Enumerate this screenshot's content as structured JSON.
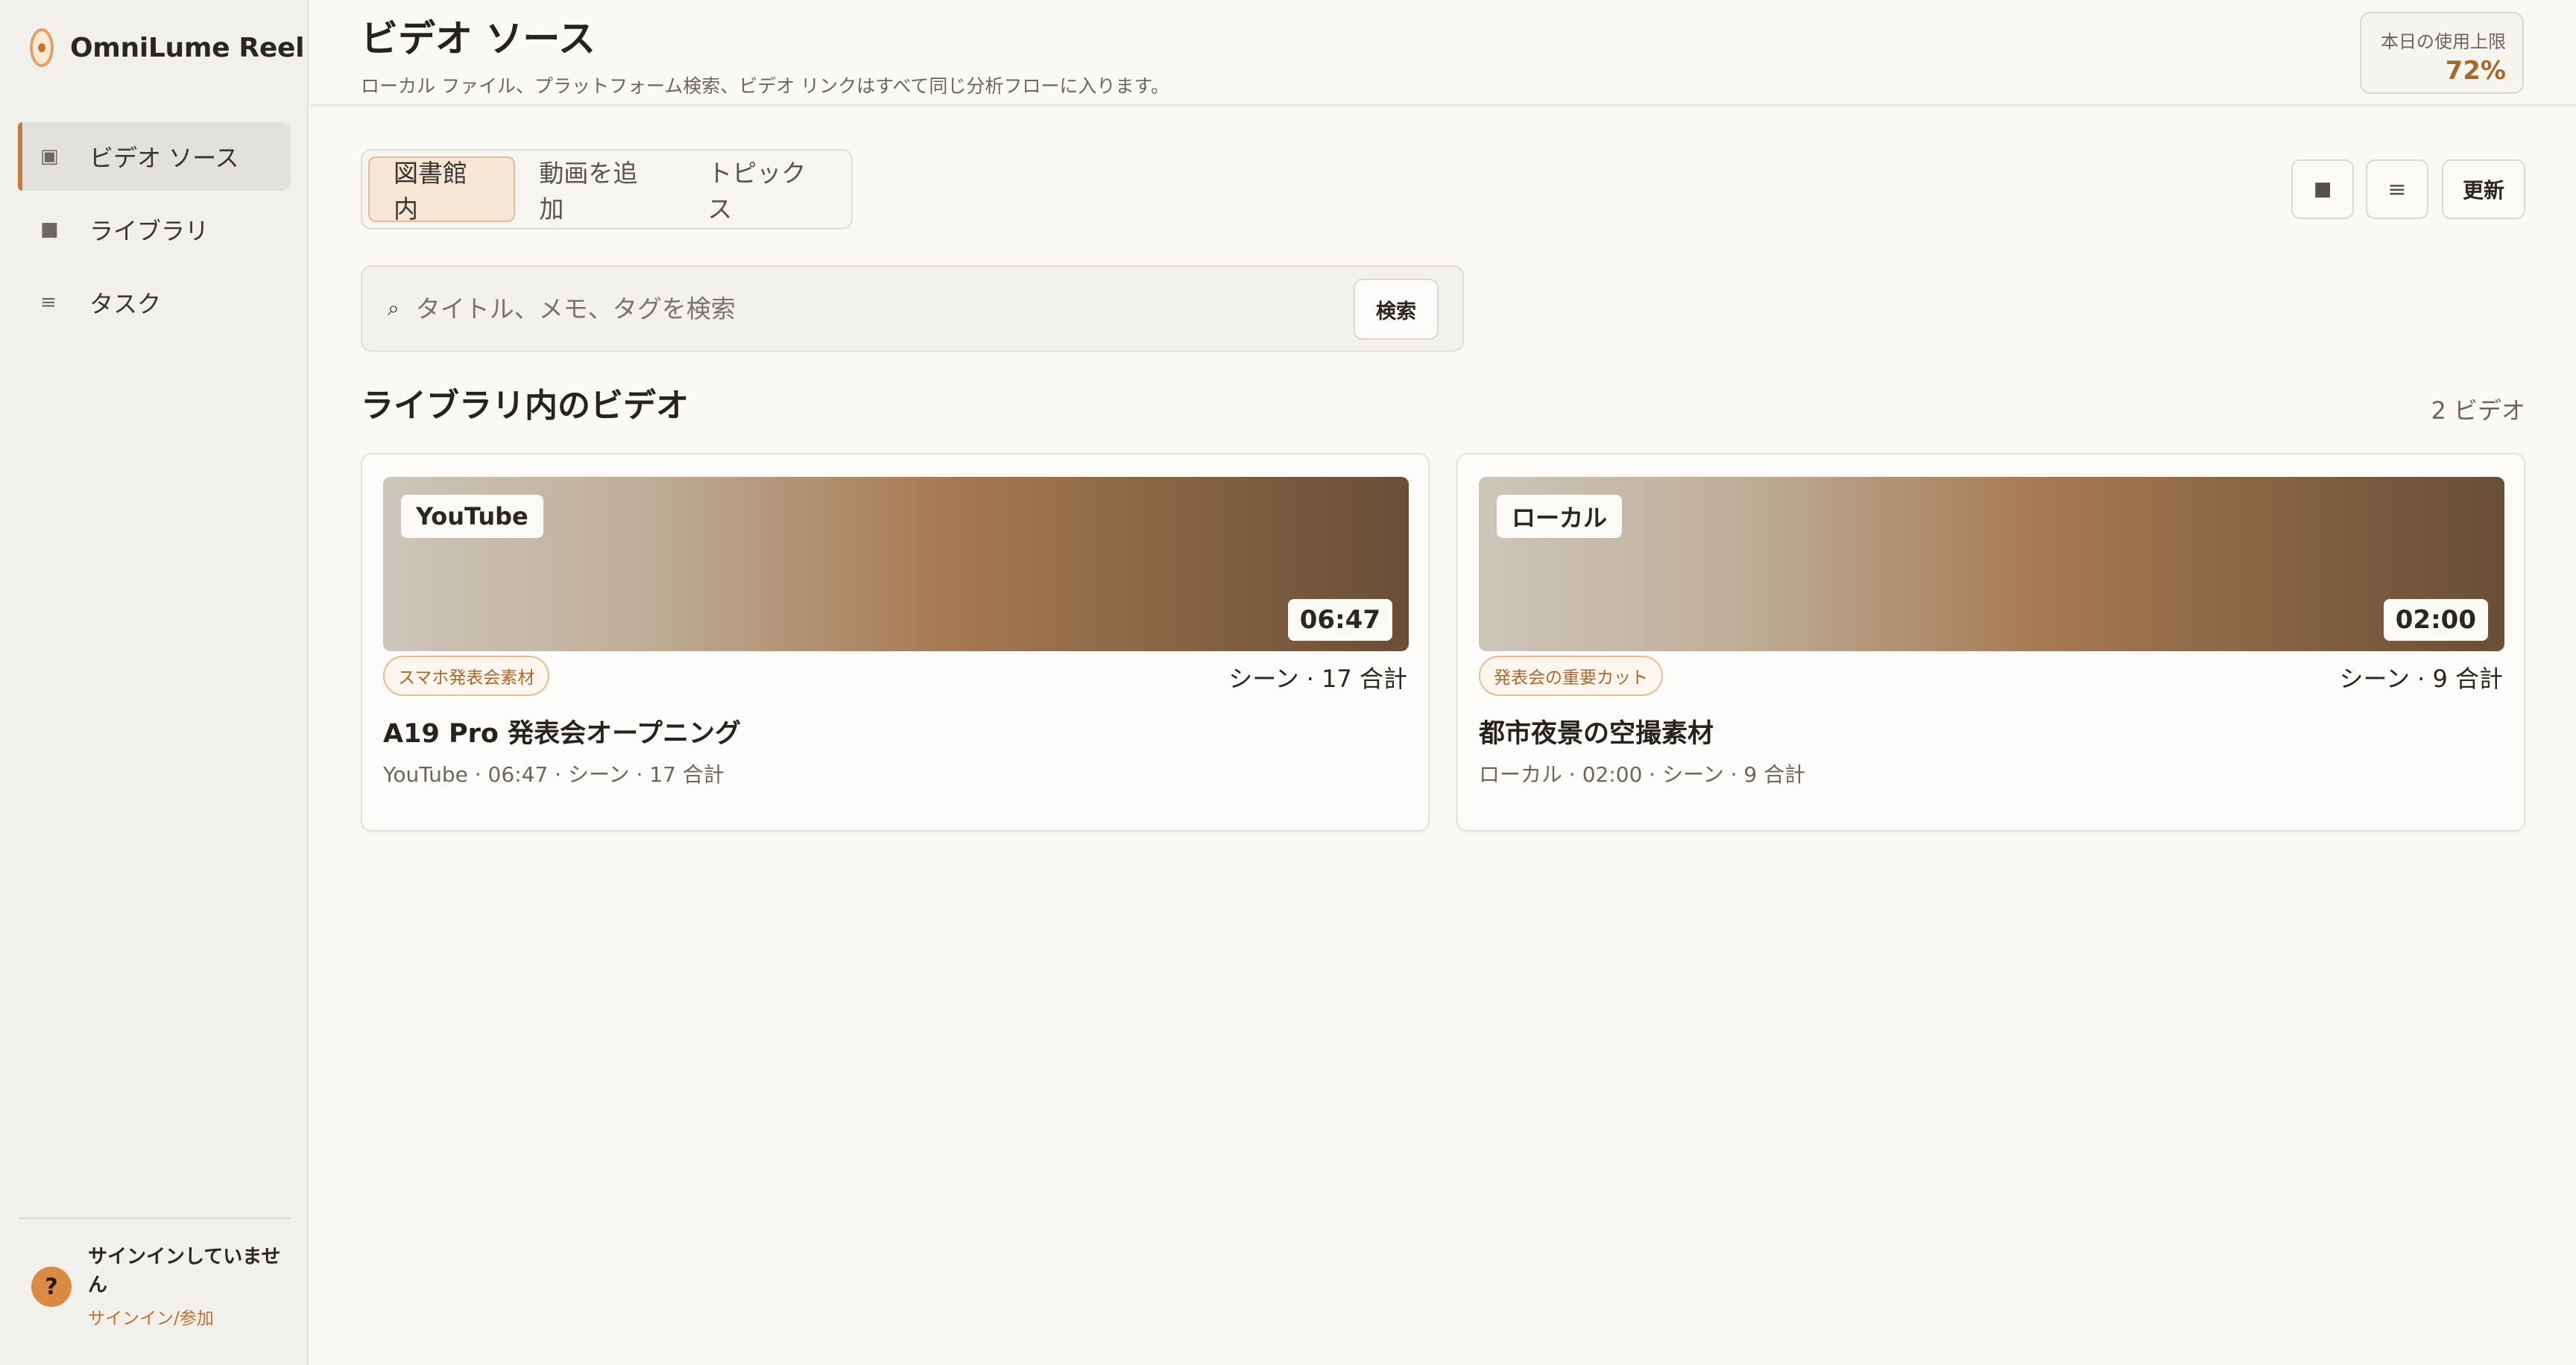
{
  "app": {
    "name": "OmniLume Reel"
  },
  "sidebar": {
    "items": [
      {
        "label": "ビデオ ソース",
        "icon": "▣",
        "active": true
      },
      {
        "label": "ライブラリ",
        "icon": "■",
        "active": false
      },
      {
        "label": "タスク",
        "icon": "≡",
        "active": false
      }
    ],
    "account": {
      "avatar": "?",
      "status": "サインインしていません",
      "link": "サインイン/参加"
    }
  },
  "header": {
    "title": "ビデオ ソース",
    "subtitle": "ローカル ファイル、プラットフォーム検索、ビデオ リンクはすべて同じ分析フローに入ります。",
    "usage_label": "本日の使用上限",
    "usage_value": "72%"
  },
  "tabs": [
    {
      "label": "図書館内",
      "active": true
    },
    {
      "label": "動画を追加",
      "active": false
    },
    {
      "label": "トピックス",
      "active": false
    }
  ],
  "toolbar": {
    "grid_icon": "■",
    "list_icon": "≡",
    "refresh_label": "更新"
  },
  "search": {
    "icon": "⌕",
    "placeholder": "タイトル、メモ、タグを検索",
    "value": "",
    "button_label": "検索"
  },
  "library": {
    "title": "ライブラリ内のビデオ",
    "count": "2 ビデオ",
    "videos": [
      {
        "source": "YouTube",
        "duration": "06:47",
        "tag": "スマホ発表会素材",
        "scenes": "シーン · 17 合計",
        "title": "A19 Pro 発表会オープニング",
        "meta": "YouTube · 06:47 · シーン · 17 合計"
      },
      {
        "source": "ローカル",
        "duration": "02:00",
        "tag": "発表会の重要カット",
        "scenes": "シーン · 9 合計",
        "title": "都市夜景の空撮素材",
        "meta": "ローカル · 02:00 · シーン · 9 合計"
      }
    ]
  },
  "colors": {
    "accent": "#c97a3a",
    "usage_value": "#a7682b",
    "tag_text": "#a9682e",
    "sidebar_bg": "#f2f0ec",
    "page_bg": "#faf9f6"
  }
}
